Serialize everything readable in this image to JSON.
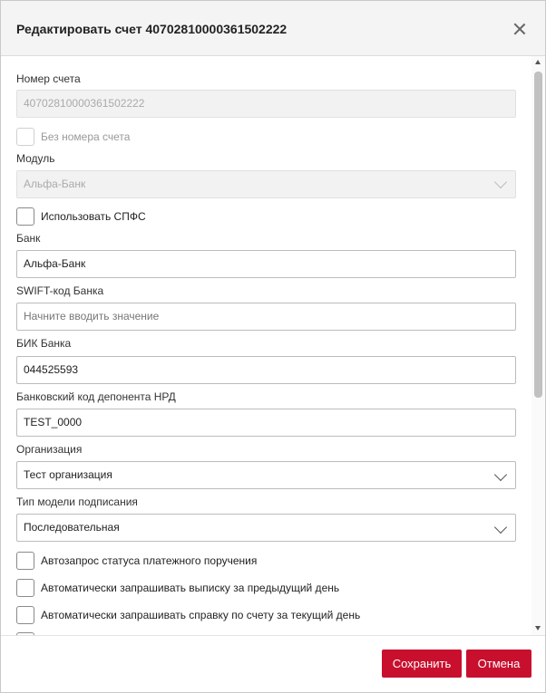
{
  "dialog": {
    "title": "Редактировать счет 40702810000361502222",
    "close_icon": "close-icon"
  },
  "form": {
    "account_number": {
      "label": "Номер счета",
      "value": "40702810000361502222"
    },
    "no_account_number": {
      "label": "Без номера счета",
      "checked": false
    },
    "module": {
      "label": "Модуль",
      "value": "Альфа-Банк"
    },
    "use_spfs": {
      "label": "Использовать СПФС",
      "checked": false
    },
    "bank": {
      "label": "Банк",
      "value": "Альфа-Банк"
    },
    "swift": {
      "label": "SWIFT-код Банка",
      "placeholder": "Начните вводить значение"
    },
    "bik": {
      "label": "БИК Банка",
      "value": "044525593"
    },
    "nrd_code": {
      "label": "Банковский код депонента НРД",
      "value": "TEST_0000"
    },
    "organization": {
      "label": "Организация",
      "value": "Тест организация"
    },
    "signing_model": {
      "label": "Тип модели подписания",
      "value": "Последовательная"
    },
    "auto_payment_status": {
      "label": "Автозапрос статуса платежного поручения",
      "checked": false
    },
    "auto_prev_statement": {
      "label": "Автоматически запрашивать выписку за предыдущий день",
      "checked": false
    },
    "auto_account_reference": {
      "label": "Автоматически запрашивать справку по счету за текущий день",
      "checked": false
    }
  },
  "footer": {
    "save_label": "Сохранить",
    "cancel_label": "Отмена"
  },
  "colors": {
    "accent": "#c8102e",
    "header_bg": "#f4f4f4"
  }
}
